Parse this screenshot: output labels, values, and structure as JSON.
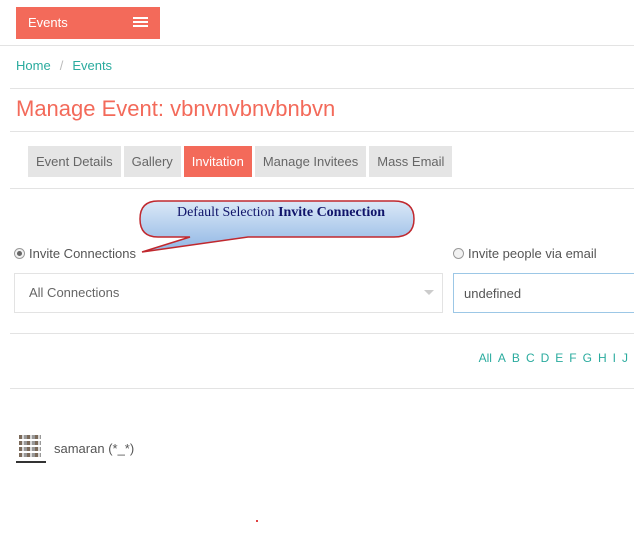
{
  "topbar": {
    "events_label": "Events"
  },
  "breadcrumb": {
    "home": "Home",
    "separator": "/",
    "current": "Events"
  },
  "page_title": "Manage Event: vbnvnvbnvbnbvn",
  "tabs": [
    {
      "label": "Event Details",
      "active": false
    },
    {
      "label": "Gallery",
      "active": false
    },
    {
      "label": "Invitation",
      "active": true
    },
    {
      "label": "Manage Invitees",
      "active": false
    },
    {
      "label": "Mass Email",
      "active": false
    }
  ],
  "callout": {
    "prefix": "Default Selection ",
    "bold": "Invite Connection"
  },
  "invite": {
    "connections_label": "Invite Connections",
    "email_label": "Invite people via email",
    "select_value": "All Connections",
    "email_value": "undefined"
  },
  "alphabet": [
    "All",
    "A",
    "B",
    "C",
    "D",
    "E",
    "F",
    "G",
    "H",
    "I",
    "J"
  ],
  "contacts": [
    {
      "name": "samaran (*_*)"
    }
  ],
  "colors": {
    "accent": "#f36a5a",
    "link": "#2aab9e",
    "callout_fill": "#b8d2ef",
    "callout_border": "#c0282e"
  }
}
